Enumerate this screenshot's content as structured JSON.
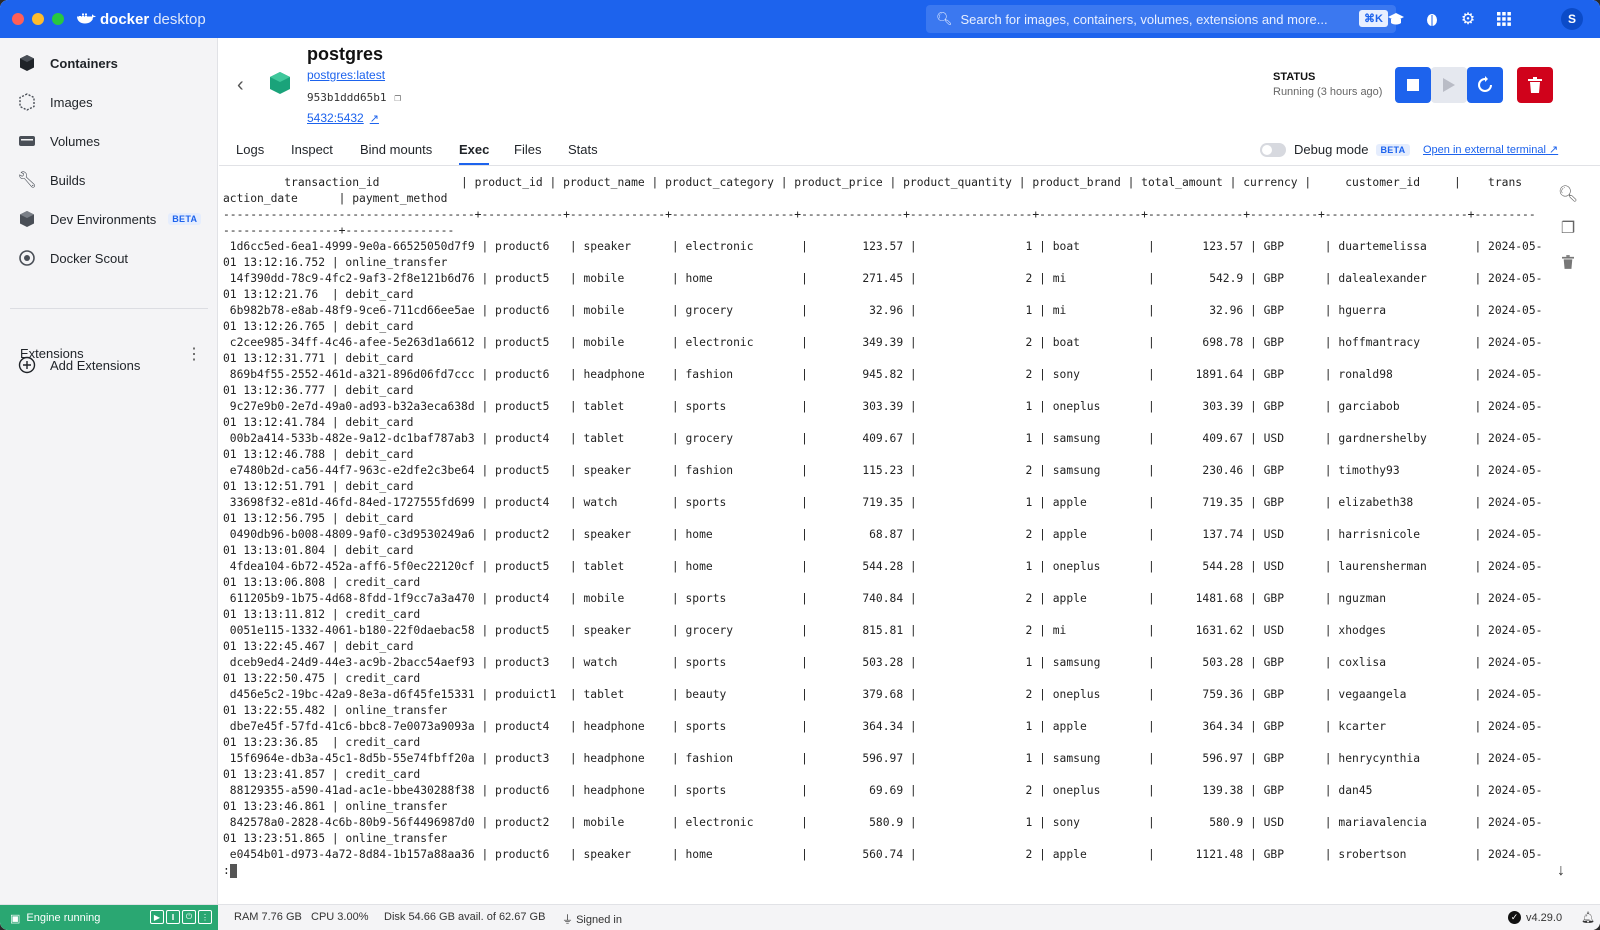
{
  "app": {
    "brand_bold": "docker",
    "brand_light": "desktop",
    "search_placeholder": "Search for images, containers, volumes, extensions and more...",
    "search_shortcut": "⌘K",
    "avatar_initial": "S"
  },
  "sidebar": {
    "items": [
      {
        "label": "Containers",
        "icon": "container-icon"
      },
      {
        "label": "Images",
        "icon": "image-icon"
      },
      {
        "label": "Volumes",
        "icon": "volume-icon"
      },
      {
        "label": "Builds",
        "icon": "wrench-icon"
      },
      {
        "label": "Dev Environments",
        "icon": "dev-env-icon",
        "badge": "BETA"
      },
      {
        "label": "Docker Scout",
        "icon": "scout-icon"
      }
    ],
    "extensions_label": "Extensions",
    "add_extensions_label": "Add Extensions"
  },
  "container": {
    "name": "postgres",
    "image": "postgres:latest",
    "id": "953b1ddd65b1",
    "port": "5432:5432",
    "status_label": "STATUS",
    "status_value": "Running (3 hours ago)"
  },
  "tabs": [
    "Logs",
    "Inspect",
    "Bind mounts",
    "Exec",
    "Files",
    "Stats"
  ],
  "active_tab": "Exec",
  "debug": {
    "label": "Debug mode",
    "badge": "BETA",
    "external_terminal": "Open in external terminal"
  },
  "terminal": {
    "lines": [
      "         transaction_id            | product_id | product_name | product_category | product_price | product_quantity | product_brand | total_amount | currency |     customer_id     |    trans",
      "action_date      | payment_method",
      "-------------------------------------+------------+--------------+------------------+---------------+------------------+---------------+--------------+----------+---------------------+---------",
      "-----------------+----------------",
      " 1d6cc5ed-6ea1-4999-9e0a-66525050d7f9 | product6   | speaker      | electronic       |        123.57 |                1 | boat          |       123.57 | GBP      | duartemelissa       | 2024-05-",
      "01 13:12:16.752 | online_transfer",
      " 14f390dd-78c9-4fc2-9af3-2f8e121b6d76 | product5   | mobile       | home             |        271.45 |                2 | mi            |        542.9 | GBP      | dalealexander       | 2024-05-",
      "01 13:12:21.76  | debit_card",
      " 6b982b78-e8ab-48f9-9ce6-711cd66ee5ae | product6   | mobile       | grocery          |         32.96 |                1 | mi            |        32.96 | GBP      | hguerra             | 2024-05-",
      "01 13:12:26.765 | debit_card",
      " c2cee985-34ff-4c46-afee-5e263d1a6612 | product5   | mobile       | electronic       |        349.39 |                2 | boat          |       698.78 | GBP      | hoffmantracy        | 2024-05-",
      "01 13:12:31.771 | debit_card",
      " 869b4f55-2552-461d-a321-896d06fd7ccc | product6   | headphone    | fashion          |        945.82 |                2 | sony          |      1891.64 | GBP      | ronald98            | 2024-05-",
      "01 13:12:36.777 | debit_card",
      " 9c27e9b0-2e7d-49a0-ad93-b32a3eca638d | product5   | tablet       | sports           |        303.39 |                1 | oneplus       |       303.39 | GBP      | garciabob           | 2024-05-",
      "01 13:12:41.784 | debit_card",
      " 00b2a414-533b-482e-9a12-dc1baf787ab3 | product4   | tablet       | grocery          |        409.67 |                1 | samsung       |       409.67 | USD      | gardnershelby       | 2024-05-",
      "01 13:12:46.788 | debit_card",
      " e7480b2d-ca56-44f7-963c-e2dfe2c3be64 | product5   | speaker      | fashion          |        115.23 |                2 | samsung       |       230.46 | GBP      | timothy93           | 2024-05-",
      "01 13:12:51.791 | debit_card",
      " 33698f32-e81d-46fd-84ed-1727555fd699 | product4   | watch        | sports           |        719.35 |                1 | apple         |       719.35 | GBP      | elizabeth38         | 2024-05-",
      "01 13:12:56.795 | debit_card",
      " 0490db96-b008-4809-9af0-c3d9530249a6 | product2   | speaker      | home             |         68.87 |                2 | apple         |       137.74 | USD      | harrisnicole        | 2024-05-",
      "01 13:13:01.804 | debit_card",
      " 4fdea104-6b72-452a-aff6-5f0ec22120cf | product5   | tablet       | home             |        544.28 |                1 | oneplus       |       544.28 | USD      | laurensherman       | 2024-05-",
      "01 13:13:06.808 | credit_card",
      " 611205b9-1b75-4d68-8fdd-1f9cc7a3a470 | product4   | mobile       | sports           |        740.84 |                2 | apple         |      1481.68 | GBP      | nguzman             | 2024-05-",
      "01 13:13:11.812 | credit_card",
      " 0051e115-1332-4061-b180-22f0daebac58 | product5   | speaker      | grocery          |        815.81 |                2 | mi            |      1631.62 | USD      | xhodges             | 2024-05-",
      "01 13:22:45.467 | debit_card",
      " dceb9ed4-24d9-44e3-ac9b-2bacc54aef93 | product3   | watch        | sports           |        503.28 |                1 | samsung       |       503.28 | GBP      | coxlisa             | 2024-05-",
      "01 13:22:50.475 | credit_card",
      " d456e5c2-19bc-42a9-8e3a-d6f45fe15331 | produict1  | tablet       | beauty           |        379.68 |                2 | oneplus       |       759.36 | GBP      | vegaangela          | 2024-05-",
      "01 13:22:55.482 | online_transfer",
      " dbe7e45f-57fd-41c6-bbc8-7e0073a9093a | product4   | headphone    | sports           |        364.34 |                1 | apple         |       364.34 | GBP      | kcarter             | 2024-05-",
      "01 13:23:36.85  | credit_card",
      " 15f6964e-db3a-45c1-8d5b-55e74fbff20a | product3   | headphone    | fashion          |        596.97 |                1 | samsung       |       596.97 | GBP      | henrycynthia        | 2024-05-",
      "01 13:23:41.857 | credit_card",
      " 88129355-a590-41ad-ac1e-bbe430288f38 | product6   | headphone    | sports           |         69.69 |                2 | oneplus       |       139.38 | GBP      | dan45               | 2024-05-",
      "01 13:23:46.861 | online_transfer",
      " 842578a0-2828-4c6b-80b9-56f4496987d0 | product2   | mobile       | electronic       |         580.9 |                1 | sony          |        580.9 | USD      | mariavalencia       | 2024-05-",
      "01 13:23:51.865 | online_transfer",
      " e0454b01-d973-4a72-8d84-1b157a88aa36 | product6   | speaker      | home             |        560.74 |                2 | apple         |      1121.48 | GBP      | srobertson          | 2024-05-"
    ],
    "prompt": ":"
  },
  "footer": {
    "engine": "Engine running",
    "ram": "RAM 7.76 GB",
    "cpu": "CPU 3.00%",
    "disk": "Disk 54.66 GB avail. of 62.67 GB",
    "signed_in": "Signed in",
    "version": "v4.29.0"
  },
  "colors": {
    "brand_blue": "#1d63ed",
    "engine_green": "#2aa772",
    "delete_red": "#d0021b"
  }
}
